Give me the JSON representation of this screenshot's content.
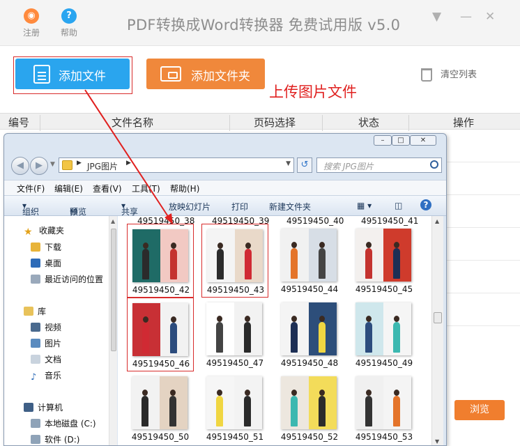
{
  "app": {
    "title": "PDF转换成Word转换器 免费试用版 v5.0",
    "register_label": "注册",
    "help_label": "帮助"
  },
  "toolbar": {
    "add_file_label": "添加文件",
    "add_folder_label": "添加文件夹",
    "clear_list_label": "清空列表"
  },
  "annotation": "上传图片文件",
  "table": {
    "headers": [
      "编号",
      "文件名称",
      "页码选择",
      "状态",
      "操作"
    ]
  },
  "browse_label": "浏览",
  "explorer": {
    "address_path": "JPG图片",
    "search_placeholder": "搜索 JPG图片",
    "menu": [
      "文件(F)",
      "编辑(E)",
      "查看(V)",
      "工具(T)",
      "帮助(H)"
    ],
    "commands": [
      "组织",
      "预览",
      "共享",
      "放映幻灯片",
      "打印",
      "新建文件夹"
    ],
    "sidebar": {
      "favorites_label": "收藏夹",
      "favorites": [
        "下载",
        "桌面",
        "最近访问的位置"
      ],
      "library_label": "库",
      "libraries": [
        "视频",
        "图片",
        "文档",
        "音乐"
      ],
      "computer_label": "计算机",
      "drives": [
        "本地磁盘 (C:)",
        "软件 (D:)"
      ]
    },
    "partial_row": [
      "49519450_38",
      "49519450_39",
      "49519450_40",
      "49519450_41"
    ],
    "files": [
      {
        "name": "49519450_42",
        "selected": true
      },
      {
        "name": "49519450_43",
        "selected": true
      },
      {
        "name": "49519450_44",
        "selected": false
      },
      {
        "name": "49519450_45",
        "selected": false
      },
      {
        "name": "49519450_46",
        "selected": true
      },
      {
        "name": "49519450_47",
        "selected": false
      },
      {
        "name": "49519450_48",
        "selected": false
      },
      {
        "name": "49519450_49",
        "selected": false
      },
      {
        "name": "49519450_50",
        "selected": false
      },
      {
        "name": "49519450_51",
        "selected": false
      },
      {
        "name": "49519450_52",
        "selected": false
      },
      {
        "name": "49519450_53",
        "selected": false
      }
    ]
  },
  "colors": {
    "accent_blue": "#2aa5ee",
    "accent_orange": "#f0883b",
    "annotation_red": "#e0201f"
  }
}
